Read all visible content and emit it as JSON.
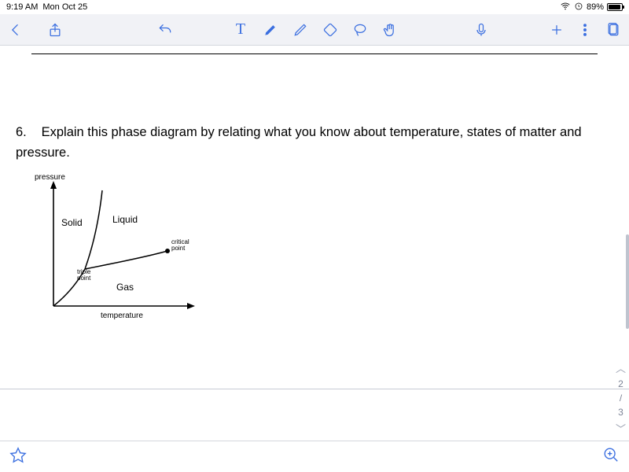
{
  "status": {
    "time": "9:19 AM",
    "date": "Mon Oct 25",
    "battery_pct": "89%"
  },
  "toolbar": {
    "back": "Back",
    "share": "Share",
    "undo": "Undo",
    "text_tool": "Text",
    "marker": "Marker",
    "pen": "Pen",
    "eraser": "Eraser",
    "lasso": "Lasso",
    "hand": "Hand",
    "mic": "Microphone",
    "add": "Add",
    "more": "More",
    "clipboard": "Paste"
  },
  "question": {
    "number": "6.",
    "text": "Explain this phase diagram by relating what you know about temperature, states of matter and pressure."
  },
  "diagram": {
    "y_axis": "pressure",
    "x_axis": "temperature",
    "region_solid": "Solid",
    "region_liquid": "Liquid",
    "region_gas": "Gas",
    "triple_point": "triple\npoint",
    "critical_point": "critical\npoint"
  },
  "pager": {
    "current": "2",
    "sep": "/",
    "total": "3"
  },
  "bottom": {
    "favorite": "Favorite",
    "zoom_in": "Zoom In"
  }
}
